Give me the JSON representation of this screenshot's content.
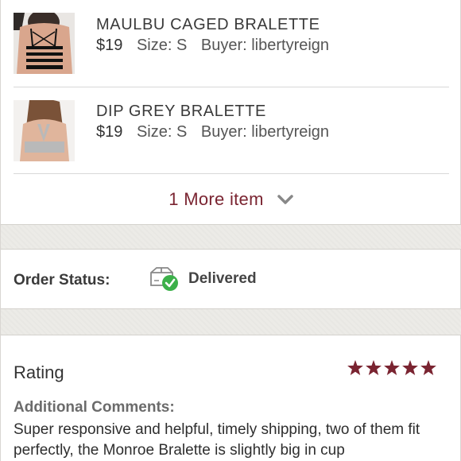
{
  "items": [
    {
      "title": "MAULBU CAGED BRALETTE",
      "price": "$19",
      "size": "Size: S",
      "buyer": "Buyer: libertyreign",
      "thumb_icon": "black-caged-bralette-photo"
    },
    {
      "title": "DIP GREY BRALETTE",
      "price": "$19",
      "size": "Size: S",
      "buyer": "Buyer: libertyreign",
      "thumb_icon": "grey-racerback-bralette-photo"
    }
  ],
  "more_items": {
    "label": "1 More item",
    "icon": "chevron-down-icon"
  },
  "order_status": {
    "label": "Order Status:",
    "value": "Delivered",
    "icon": "box-delivered-check-icon"
  },
  "rating": {
    "title": "Rating",
    "stars": 5,
    "max_stars": 5,
    "comments_label": "Additional Comments:",
    "comments_text": "Super responsive and helpful, timely shipping, two of them fit perfectly, the Monroe Bralette is slightly big in cup"
  },
  "colors": {
    "accent": "#7a2431",
    "success": "#3cb04a",
    "band": "#ecebe7"
  }
}
